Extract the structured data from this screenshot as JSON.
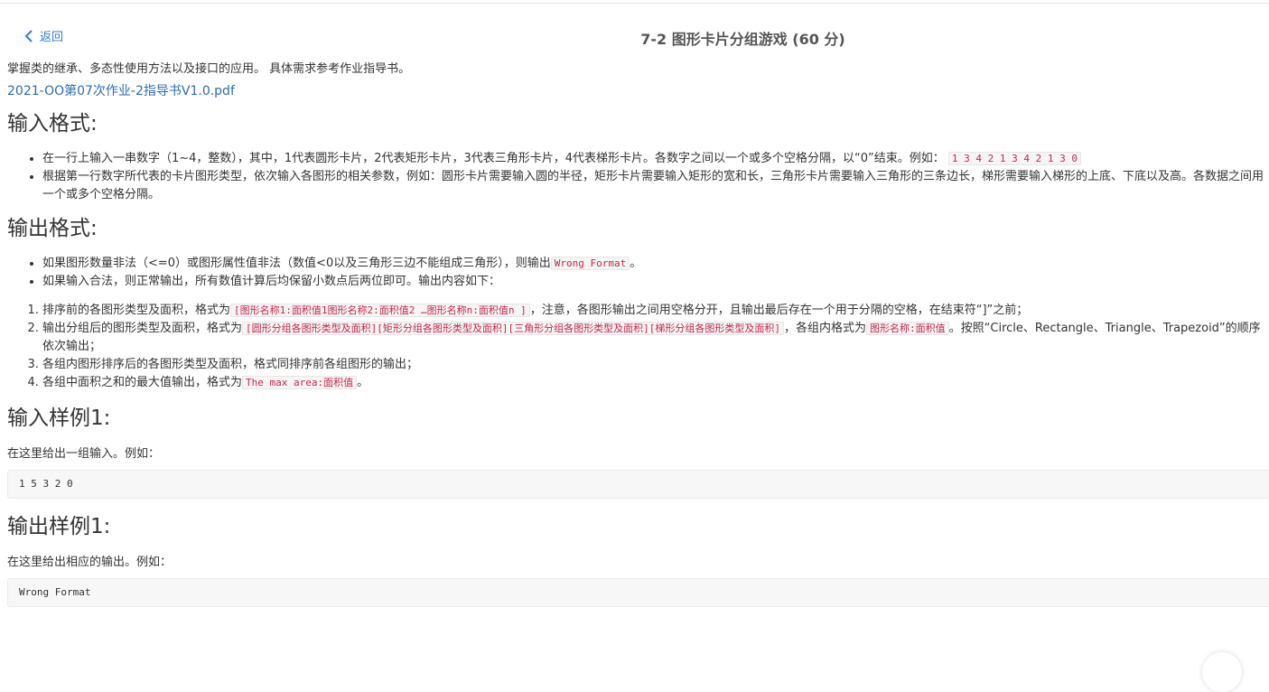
{
  "header": {
    "back_label": "返回",
    "title": "7-2 图形卡片分组游戏 (60 分)"
  },
  "intro": {
    "text": "掌握类的继承、多态性使用方法以及接口的应用。 具体需求参考作业指导书。",
    "link": "2021-OO第07次作业-2指导书V1.0.pdf"
  },
  "input_format": {
    "heading": "输入格式:",
    "bullet1_text": "在一行上输入一串数字（1~4，整数），其中，1代表圆形卡片，2代表矩形卡片，3代表三角形卡片，4代表梯形卡片。各数字之间以一个或多个空格分隔，以“0”结束。例如：",
    "bullet1_code": "1 3 4 2 1 3 4 2 1 3 0",
    "bullet2_text": "根据第一行数字所代表的卡片图形类型，依次输入各图形的相关参数，例如：圆形卡片需要输入圆的半径，矩形卡片需要输入矩形的宽和长，三角形卡片需要输入三角形的三条边长，梯形需要输入梯形的上底、下底以及高。各数据之间用一个或多个空格分隔。"
  },
  "output_format": {
    "heading": "输出格式:",
    "bullet1_text": "如果图形数量非法（<=0）或图形属性值非法（数值<0以及三角形三边不能组成三角形），则输出",
    "bullet1_code": "Wrong Format",
    "bullet1_tail": "。",
    "bullet2_text": "如果输入合法，则正常输出，所有数值计算后均保留小数点后两位即可。输出内容如下：",
    "item1_text": "排序前的各图形类型及面积，格式为",
    "item1_code": "[图形名称1:面积值1图形名称2:面积值2 …图形名称n:面积值n ]",
    "item1_tail": "，注意，各图形输出之间用空格分开，且输出最后存在一个用于分隔的空格，在结束符“]”之前；",
    "item2_text": "输出分组后的图形类型及面积，格式为",
    "item2_code": "[圆形分组各图形类型及面积][矩形分组各图形类型及面积][三角形分组各图形类型及面积][梯形分组各图形类型及面积]",
    "item2_mid": "，各组内格式为",
    "item2_code2": "图形名称:面积值",
    "item2_tail": "。按照“Circle、Rectangle、Triangle、Trapezoid”的顺序依次输出；",
    "item3_text": "各组内图形排序后的各图形类型及面积，格式同排序前各组图形的输出；",
    "item4_text": "各组中面积之和的最大值输出，格式为",
    "item4_code": "The max area:面积值",
    "item4_tail": "。"
  },
  "sample_input": {
    "heading": "输入样例1:",
    "label": "在这里给出一组输入。例如：",
    "code": "1 5 3 2 0"
  },
  "sample_output": {
    "heading": "输出样例1:",
    "label": "在这里给出相应的输出。例如：",
    "code": "Wrong Format"
  }
}
